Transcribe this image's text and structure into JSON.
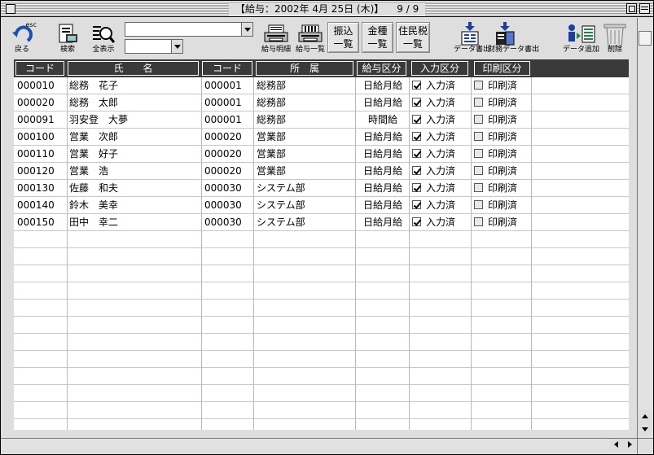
{
  "window": {
    "title": "【給与：2002年 4月 25日 (木)】",
    "page": "9 / 9"
  },
  "toolbar": {
    "back": {
      "label": "戻る",
      "hotkey": "esc",
      "icon": "back-arrow-icon"
    },
    "search": {
      "label": "検索",
      "icon": "search-doc-icon"
    },
    "show_all": {
      "label": "全表示",
      "icon": "magnifier-icon"
    },
    "combo1_value": "",
    "combo2_value": "",
    "payslip": {
      "label": "給与明細",
      "icon": "printer-icon"
    },
    "paylist": {
      "label": "給与一覧",
      "icon": "printer-icon"
    },
    "furikomi": {
      "line1": "振込",
      "line2": "一覧"
    },
    "kinshu": {
      "line1": "金種",
      "line2": "一覧"
    },
    "juminzei": {
      "line1": "住民税",
      "line2": "一覧"
    },
    "export": {
      "label": "データ書出",
      "icon": "export-doc-icon"
    },
    "fin_export": {
      "label": "財務データ書出",
      "icon": "export-ledger-icon"
    },
    "add_data": {
      "label": "データ追加",
      "icon": "add-data-icon"
    },
    "delete": {
      "label": "削除",
      "icon": "trash-icon"
    }
  },
  "table": {
    "headers": {
      "code": "コード",
      "name": "氏　　名",
      "dept_code": "コード",
      "dept": "所　属",
      "pay_type": "給与区分",
      "input_status": "入力区分",
      "print_status": "印刷区分"
    },
    "rows": [
      {
        "code": "000010",
        "name": "総務　花子",
        "dept_code": "000001",
        "dept": "総務部",
        "pay_type": "日給月給",
        "input_checked": true,
        "input": "入力済",
        "print_checked": false,
        "print": "印刷済"
      },
      {
        "code": "000020",
        "name": "総務　太郎",
        "dept_code": "000001",
        "dept": "総務部",
        "pay_type": "日給月給",
        "input_checked": true,
        "input": "入力済",
        "print_checked": false,
        "print": "印刷済"
      },
      {
        "code": "000091",
        "name": "羽安登　大夢",
        "dept_code": "000001",
        "dept": "総務部",
        "pay_type": "時間給",
        "input_checked": true,
        "input": "入力済",
        "print_checked": false,
        "print": "印刷済"
      },
      {
        "code": "000100",
        "name": "営業　次郎",
        "dept_code": "000020",
        "dept": "営業部",
        "pay_type": "日給月給",
        "input_checked": true,
        "input": "入力済",
        "print_checked": false,
        "print": "印刷済"
      },
      {
        "code": "000110",
        "name": "営業　好子",
        "dept_code": "000020",
        "dept": "営業部",
        "pay_type": "日給月給",
        "input_checked": true,
        "input": "入力済",
        "print_checked": false,
        "print": "印刷済"
      },
      {
        "code": "000120",
        "name": "営業　浩",
        "dept_code": "000020",
        "dept": "営業部",
        "pay_type": "日給月給",
        "input_checked": true,
        "input": "入力済",
        "print_checked": false,
        "print": "印刷済"
      },
      {
        "code": "000130",
        "name": "佐藤　和夫",
        "dept_code": "000030",
        "dept": "システム部",
        "pay_type": "日給月給",
        "input_checked": true,
        "input": "入力済",
        "print_checked": false,
        "print": "印刷済"
      },
      {
        "code": "000140",
        "name": "鈴木　美幸",
        "dept_code": "000030",
        "dept": "システム部",
        "pay_type": "日給月給",
        "input_checked": true,
        "input": "入力済",
        "print_checked": false,
        "print": "印刷済"
      },
      {
        "code": "000150",
        "name": "田中　幸二",
        "dept_code": "000030",
        "dept": "システム部",
        "pay_type": "日給月給",
        "input_checked": true,
        "input": "入力済",
        "print_checked": false,
        "print": "印刷済"
      }
    ]
  }
}
